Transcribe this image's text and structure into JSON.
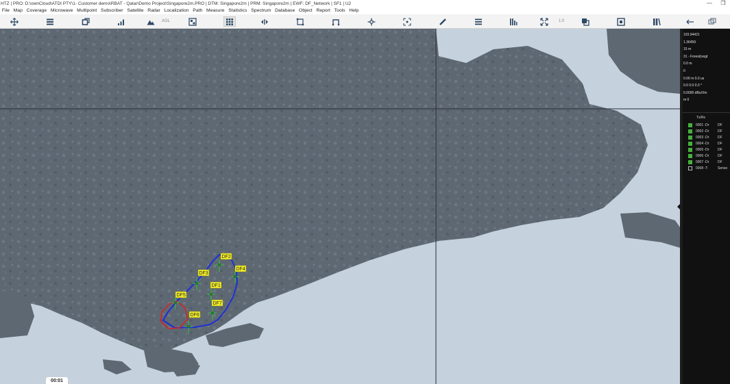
{
  "window": {
    "title": "HTZ | PRO: D:\\ownCloud\\ATDI PTY\\1- Customer demo\\RBAT - Qatar\\Demo Project\\Singapore2m.PRO | DTM: Singapore2m | PRM: Singapore2m | EWF: DF_Network | SF1 | U2",
    "minimize": "—",
    "maximize": "❐"
  },
  "menu": [
    "File",
    "Map",
    "Coverage",
    "Microwave",
    "Multipoint",
    "Subscriber",
    "Satellite",
    "Radar",
    "Localization",
    "Path",
    "Measure",
    "Statistics",
    "Spectrum",
    "Database",
    "Object",
    "Report",
    "Tools",
    "Help"
  ],
  "toolbar": {
    "agl_label": "AGL",
    "ratio_label": "1:0",
    "icons": [
      "move-icon",
      "layers-icon",
      "coverage-icon",
      "signal-icon",
      "terrain-icon",
      "agl-panel-icon",
      "grid-icon",
      "pan-icon",
      "polygon-icon",
      "path-icon",
      "network-icon",
      "target-icon",
      "ruler-icon",
      "list-icon",
      "bars-icon",
      "fullscreen-icon",
      "windows-icon",
      "frame-icon",
      "split-icon",
      "back-icon",
      "overlay-icon"
    ]
  },
  "map": {
    "sea_color": "#c5d1dc",
    "land_color": "#5e6873",
    "markers": [
      {
        "label": "DF2"
      },
      {
        "label": "DF3"
      },
      {
        "label": "DF4"
      },
      {
        "label": "DF1"
      },
      {
        "label": "DF5"
      },
      {
        "label": "DF7"
      },
      {
        "label": "DF6"
      }
    ]
  },
  "side_panel": {
    "readouts": [
      "103.94421",
      "1.36459",
      "15 m",
      "31 - Forest(vegt",
      "0.0 m",
      "0",
      "0.00 m 0.0 us",
      "0.0 0.0 0.0 °",
      "0.0000 dBuV/m",
      "m 0"
    ],
    "list_header": "Tx/Rx",
    "stations": [
      {
        "name": "0001 -Dr",
        "type": "DF",
        "checked": true
      },
      {
        "name": "0002 -Dr",
        "type": "DF",
        "checked": true
      },
      {
        "name": "0003 -Dr",
        "type": "DF",
        "checked": true
      },
      {
        "name": "0004 -Dr",
        "type": "DF",
        "checked": true
      },
      {
        "name": "0005 -Dr",
        "type": "DF",
        "checked": true
      },
      {
        "name": "0006 -Dr",
        "type": "DF",
        "checked": true
      },
      {
        "name": "0007 -Dr",
        "type": "DF",
        "checked": true
      },
      {
        "name": "0008 -T:",
        "type": "Senso",
        "checked": false
      }
    ]
  },
  "clock": {
    "time": "00:01"
  }
}
